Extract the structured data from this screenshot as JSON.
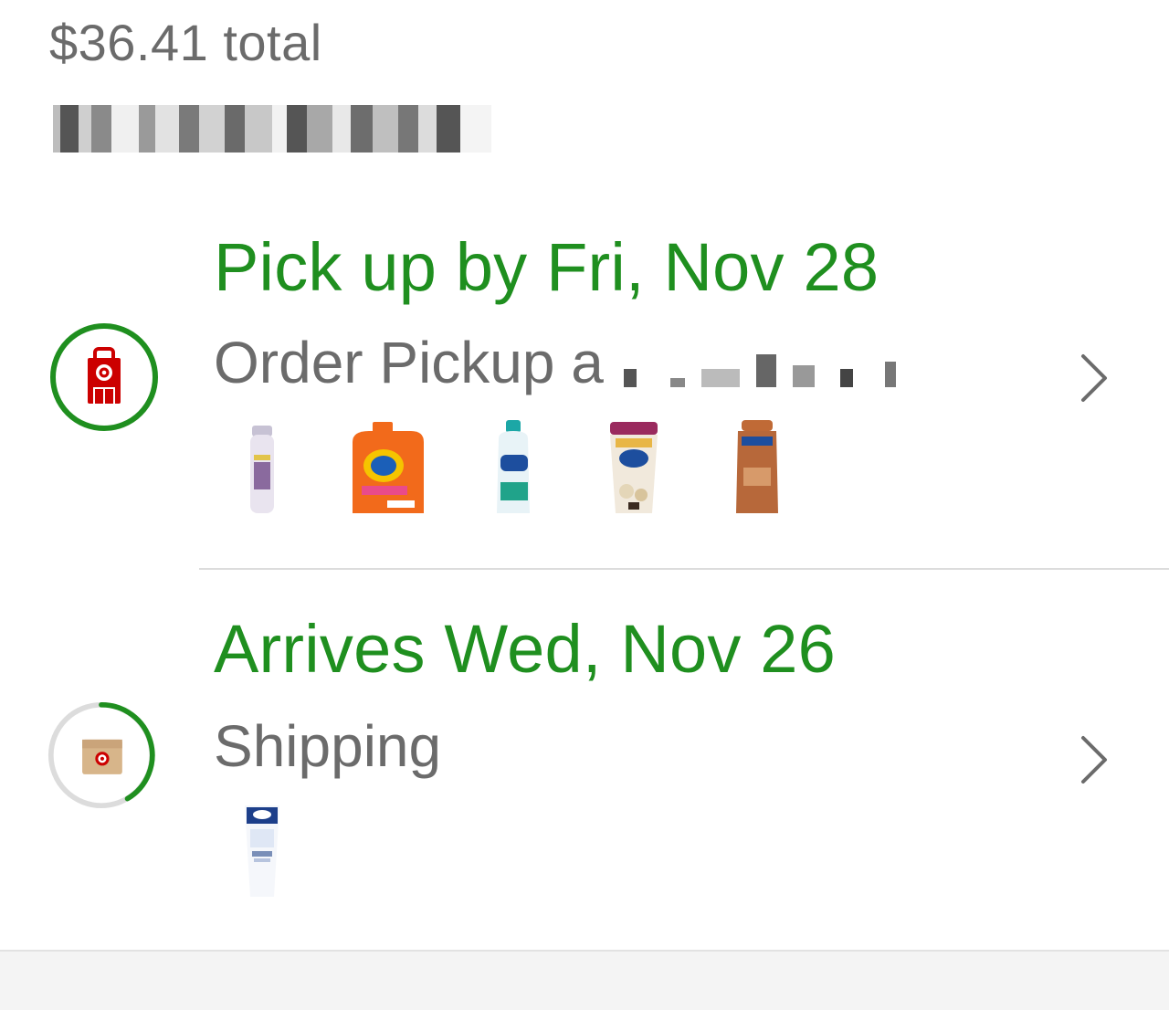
{
  "order": {
    "total_label": "$36.41 total",
    "order_number_redacted": true
  },
  "fulfillments": [
    {
      "title": "Pick up by Fri, Nov 28",
      "subtitle_prefix": "Order Pickup a",
      "subtitle_location_redacted": true,
      "icon": "store-pickup-icon",
      "status_color": "#1f8f1f",
      "progress_fraction": 1.0,
      "items": [
        {
          "name": "air-freshener-spray-thumbnail"
        },
        {
          "name": "tide-detergent-thumbnail"
        },
        {
          "name": "downy-fabric-softener-thumbnail"
        },
        {
          "name": "downy-scent-beads-thumbnail"
        },
        {
          "name": "vaseline-lotion-thumbnail"
        }
      ]
    },
    {
      "title": "Arrives Wed, Nov 26",
      "subtitle": "Shipping",
      "icon": "shipping-box-icon",
      "status_color": "#1f8f1f",
      "progress_fraction": 0.45,
      "items": [
        {
          "name": "crest-toothpaste-thumbnail"
        }
      ]
    }
  ],
  "colors": {
    "accent_green": "#1f8f1f",
    "brand_red": "#cc0000",
    "text_gray": "#6b6b6b"
  }
}
